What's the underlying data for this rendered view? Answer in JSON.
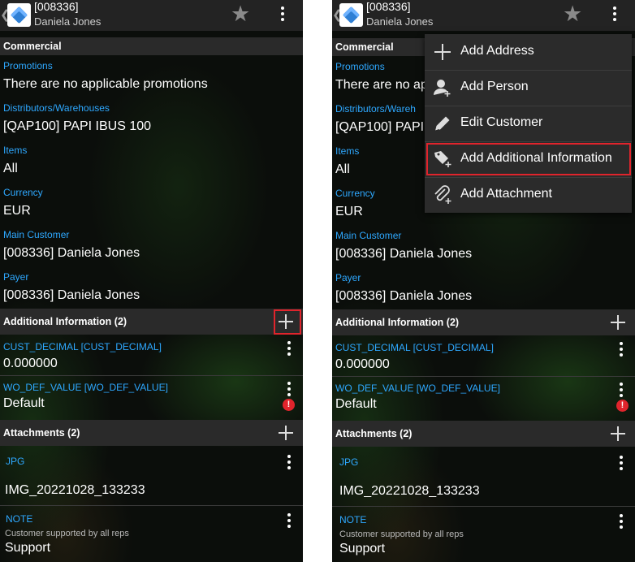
{
  "header": {
    "title": "[008336]",
    "subtitle": "Daniela Jones"
  },
  "commercial": {
    "title": "Commercial",
    "fields": [
      {
        "label": "Promotions",
        "value": "There are no applicable promotions"
      },
      {
        "label": "Distributors/Warehouses",
        "value": "[QAP100] PAPI IBUS 100"
      },
      {
        "label": "Items",
        "value": "All"
      },
      {
        "label": "Currency",
        "value": "EUR"
      },
      {
        "label": "Main Customer",
        "value": "[008336] Daniela Jones"
      },
      {
        "label": "Payer",
        "value": "[008336] Daniela Jones"
      }
    ]
  },
  "right_truncated": {
    "promotions": "There are no ap",
    "distributors_label": "Distributors/Wareh",
    "distributors_value": "[QAP100] PAPI"
  },
  "additional": {
    "title": "Additional Information (2)",
    "items": [
      {
        "label": "CUST_DECIMAL [CUST_DECIMAL]",
        "value": "0.000000"
      },
      {
        "label": "WO_DEF_VALUE [WO_DEF_VALUE]",
        "value": "Default",
        "alert": "!"
      }
    ]
  },
  "attachments": {
    "title": "Attachments (2)",
    "items": [
      {
        "label": "JPG",
        "value": "IMG_20221028_133233"
      },
      {
        "label": "NOTE",
        "note": "Customer supported by all reps",
        "value": "Support"
      }
    ]
  },
  "menu": {
    "items": [
      {
        "label": "Add Address",
        "icon": "plus-icon"
      },
      {
        "label": "Add Person",
        "icon": "person-add-icon"
      },
      {
        "label": "Edit Customer",
        "icon": "pencil-icon"
      },
      {
        "label": "Add Additional Information",
        "icon": "tag-add-icon"
      },
      {
        "label": "Add Attachment",
        "icon": "paperclip-icon"
      }
    ]
  },
  "colors": {
    "label_blue": "#2ea8ff",
    "highlight_red": "#e0242c",
    "header_bg": "#2a2a2a"
  }
}
